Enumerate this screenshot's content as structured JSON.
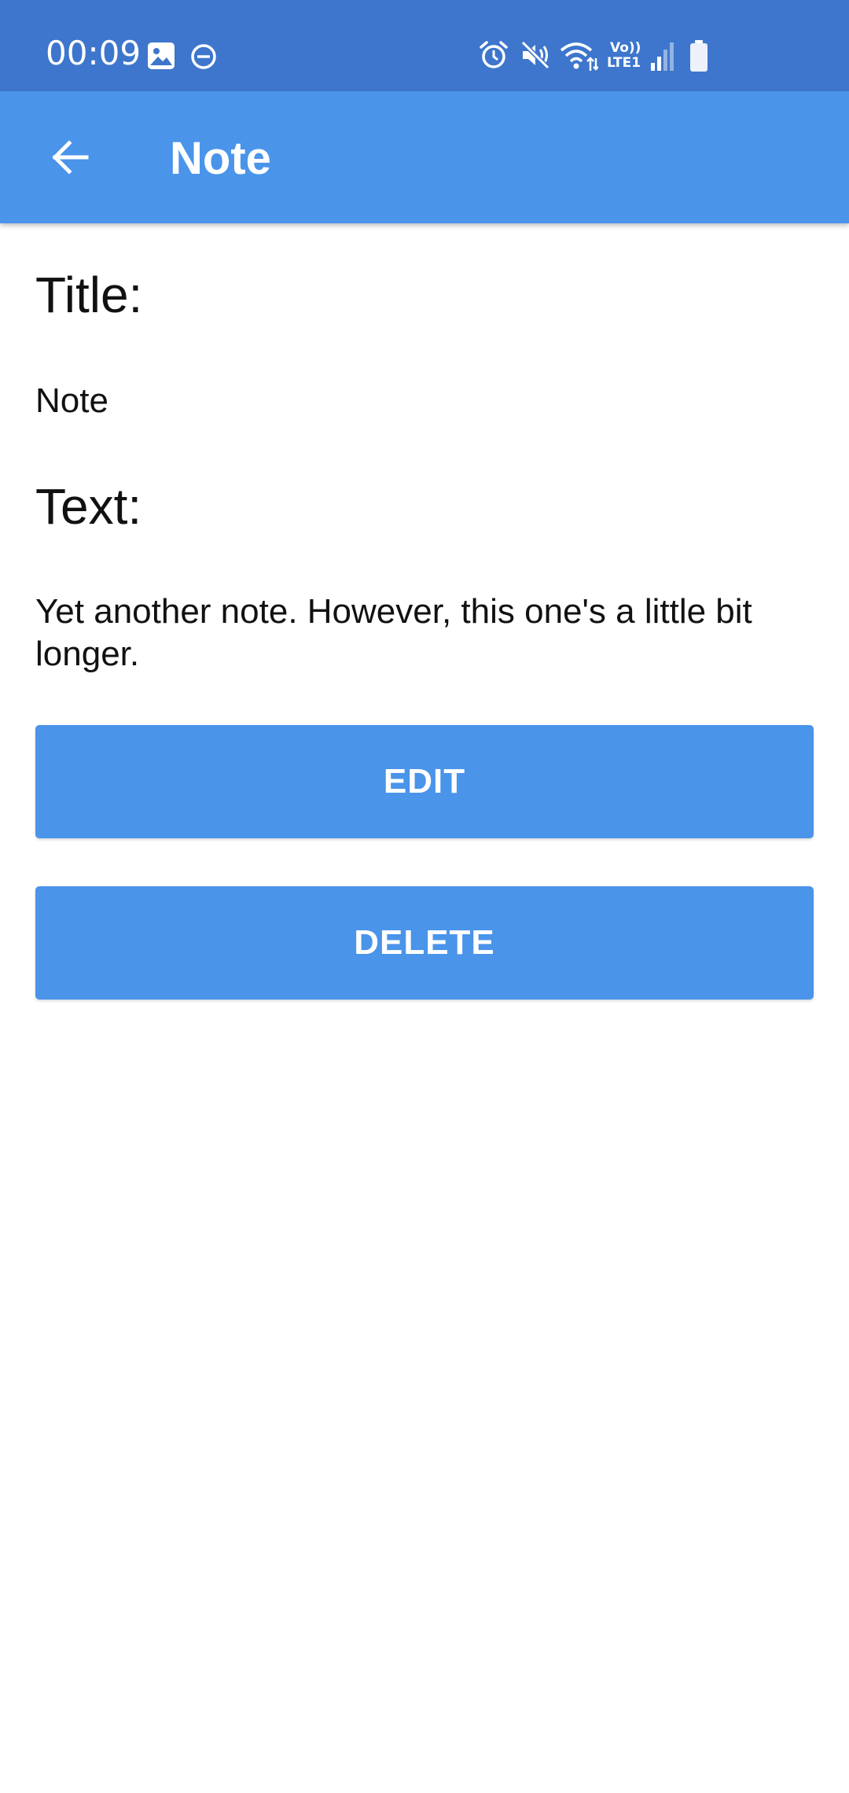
{
  "status_bar": {
    "time": "00:09",
    "network_label_top": "Vo))",
    "network_label_bottom": "LTE1",
    "icons": [
      "image-icon",
      "dnd-icon",
      "alarm-icon",
      "mute-icon",
      "wifi-icon",
      "lte-icon",
      "signal-icon",
      "battery-icon"
    ]
  },
  "app_bar": {
    "title": "Note",
    "back_icon": "arrow-left-icon"
  },
  "content": {
    "title_label": "Title:",
    "title_value": "Note",
    "text_label": "Text:",
    "text_value": "Yet another note. However, this one's a little bit longer."
  },
  "buttons": {
    "edit_label": "EDIT",
    "delete_label": "DELETE"
  },
  "colors": {
    "status_bar": "#3d76cc",
    "primary": "#4a94ea",
    "on_primary": "#ffffff",
    "text": "#111111"
  }
}
